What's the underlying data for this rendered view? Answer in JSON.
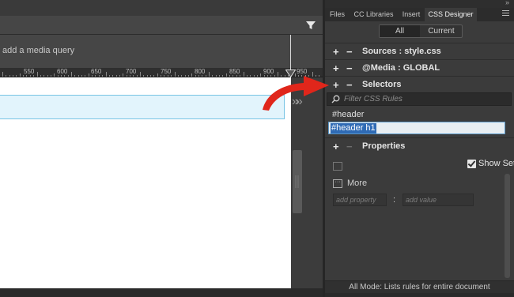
{
  "document": {
    "media_query_placeholder": "add a media query",
    "ruler_labels": [
      "550",
      "600",
      "650",
      "700",
      "750",
      "800",
      "850",
      "900",
      "950"
    ]
  },
  "panel": {
    "tabs": [
      {
        "label": "Files",
        "active": false
      },
      {
        "label": "CC Libraries",
        "active": false
      },
      {
        "label": "Insert",
        "active": false
      },
      {
        "label": "CSS Designer",
        "active": true
      }
    ],
    "segment": {
      "all": "All",
      "current": "Current",
      "selected": "All"
    },
    "sources": {
      "label": "Sources :",
      "value": "style.css"
    },
    "media": {
      "label": "@Media :",
      "value": "GLOBAL"
    },
    "selectors": {
      "label": "Selectors",
      "filter_placeholder": "Filter CSS Rules",
      "items": [
        "#header"
      ],
      "editing_value": "#header h1"
    },
    "properties": {
      "label": "Properties",
      "show_set_label": "Show Set",
      "show_set_checked": true,
      "more_label": "More",
      "add_property_placeholder": "add property",
      "colon": ":",
      "add_value_placeholder": "add value"
    },
    "footer_text": "All Mode: Lists rules for entire document"
  },
  "colors": {
    "annotation_arrow": "#e0261b",
    "selection_highlight": "#2f6bb5",
    "header_box_fill": "#e2f4fc"
  }
}
